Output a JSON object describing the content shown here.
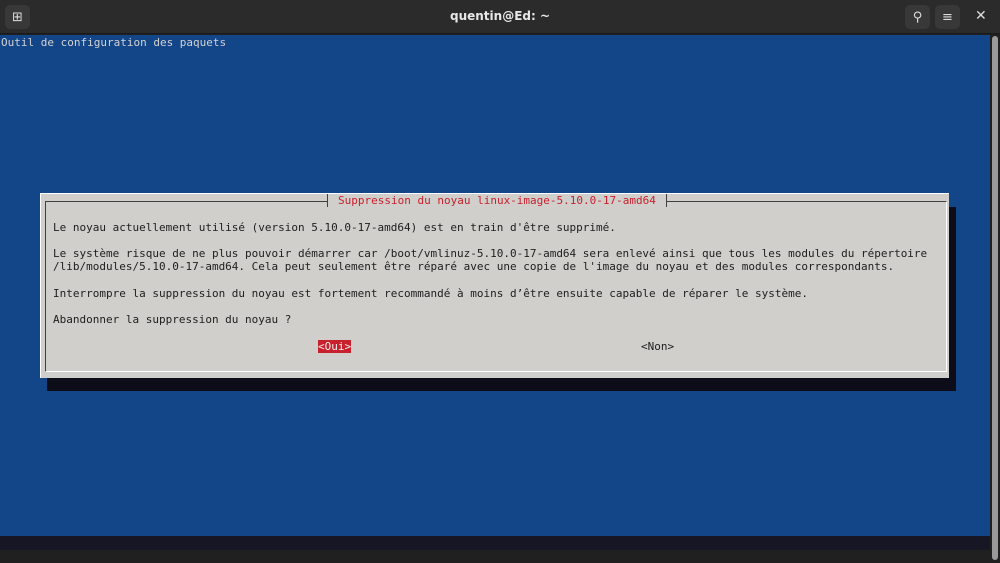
{
  "window": {
    "title": "quentin@Ed: ~"
  },
  "terminal": {
    "header": "Outil de configuration des paquets"
  },
  "dialog": {
    "title": "Suppression du noyau linux-image-5.10.0-17-amd64",
    "lines": [
      "Le noyau actuellement utilisé (version 5.10.0-17-amd64) est en train d'être supprimé.",
      "Le système risque de ne plus pouvoir démarrer car /boot/vmlinuz-5.10.0-17-amd64 sera enlevé ainsi que tous les modules du répertoire",
      "/lib/modules/5.10.0-17-amd64. Cela peut seulement être réparé avec une copie de l'image du noyau et des modules correspondants.",
      "Interrompre la suppression du noyau est fortement recommandé à moins d’être ensuite capable de réparer le système.",
      "Abandonner la suppression du noyau ?"
    ],
    "yes_label": "<Oui>",
    "no_label": "<Non>"
  }
}
